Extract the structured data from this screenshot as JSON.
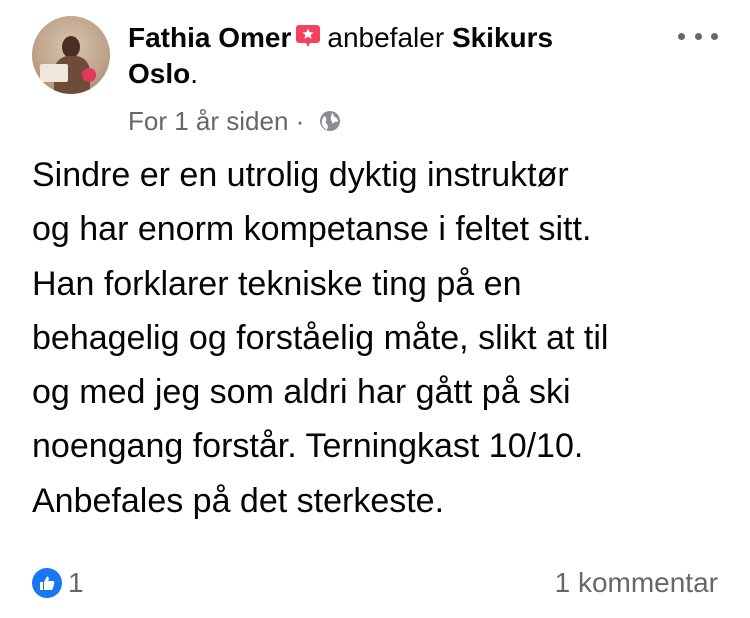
{
  "post": {
    "author": "Fathia Omer",
    "recommends_text": "anbefaler",
    "page_name": "Skikurs",
    "page_name_cont": "Oslo",
    "page_name_suffix": ".",
    "timestamp": "For 1 år siden",
    "separator": "·",
    "privacy_icon": "globe-icon",
    "recommend_icon": "recommendation-badge-icon",
    "recommend_color": "#f3425f",
    "body_lines": [
      "Sindre er en utrolig dyktig instruktør",
      "og har enorm kompetanse i feltet sitt.",
      "Han forklarer tekniske ting på en",
      "behagelig og forståelig måte, slikt at til",
      "og med jeg som aldri har gått på ski",
      "noengang forstår. Terningkast 10/10.",
      "Anbefales på det sterkeste."
    ]
  },
  "footer": {
    "like_icon": "like-icon",
    "like_color": "#1877f2",
    "like_count": "1",
    "comment_count_text": "1 kommentar"
  },
  "menu": {
    "more_icon": "more-options-icon"
  }
}
